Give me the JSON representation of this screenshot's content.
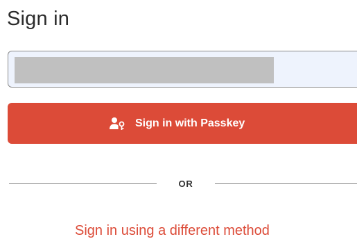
{
  "page": {
    "title": "Sign in"
  },
  "login_field": {
    "value": "",
    "state": "redacted"
  },
  "passkey_button": {
    "label": "Sign in with Passkey",
    "icon": "user-key-icon"
  },
  "divider": {
    "label": "OR"
  },
  "alternate_method": {
    "label": "Sign in using a different method"
  },
  "colors": {
    "accent": "#dc4b38",
    "field_background": "#eef3fd",
    "redaction": "#c0c0c0",
    "text": "#2b2b2b"
  }
}
